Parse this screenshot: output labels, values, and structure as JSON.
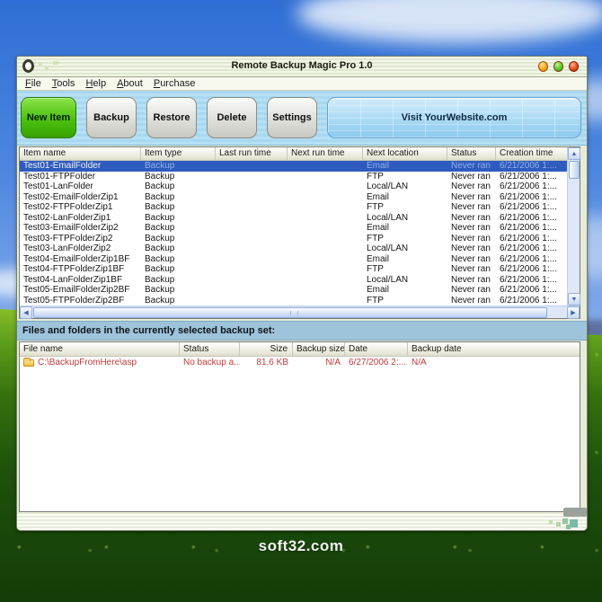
{
  "desktop": {
    "watermark": "soft32.com"
  },
  "window": {
    "title": "Remote Backup Magic Pro 1.0",
    "titlebar_buttons": [
      "minimize",
      "maximize",
      "close"
    ],
    "menu": [
      "File",
      "Tools",
      "Help",
      "About",
      "Purchase"
    ],
    "toolbar": {
      "new_item": "New Item",
      "backup": "Backup",
      "restore": "Restore",
      "delete": "Delete",
      "settings": "Settings",
      "visit": "Visit YourWebsite.com"
    },
    "backup_table": {
      "columns": [
        "Item name",
        "Item type",
        "Last run time",
        "Next run time",
        "Next location",
        "Status",
        "Creation time"
      ],
      "rows": [
        {
          "name": "Test01-EmailFolder",
          "type": "Backup",
          "last_run": "",
          "next_run": "",
          "location": "Email",
          "status": "Never ran",
          "created": "6/21/2006 1:...",
          "selected": true
        },
        {
          "name": "Test01-FTPFolder",
          "type": "Backup",
          "last_run": "",
          "next_run": "",
          "location": "FTP",
          "status": "Never ran",
          "created": "6/21/2006 1:...",
          "selected": false
        },
        {
          "name": "Test01-LanFolder",
          "type": "Backup",
          "last_run": "",
          "next_run": "",
          "location": "Local/LAN",
          "status": "Never ran",
          "created": "6/21/2006 1:...",
          "selected": false
        },
        {
          "name": "Test02-EmailFolderZip1",
          "type": "Backup",
          "last_run": "",
          "next_run": "",
          "location": "Email",
          "status": "Never ran",
          "created": "6/21/2006 1:...",
          "selected": false
        },
        {
          "name": "Test02-FTPFolderZip1",
          "type": "Backup",
          "last_run": "",
          "next_run": "",
          "location": "FTP",
          "status": "Never ran",
          "created": "6/21/2006 1:...",
          "selected": false
        },
        {
          "name": "Test02-LanFolderZip1",
          "type": "Backup",
          "last_run": "",
          "next_run": "",
          "location": "Local/LAN",
          "status": "Never ran",
          "created": "6/21/2006 1:...",
          "selected": false
        },
        {
          "name": "Test03-EmailFolderZip2",
          "type": "Backup",
          "last_run": "",
          "next_run": "",
          "location": "Email",
          "status": "Never ran",
          "created": "6/21/2006 1:...",
          "selected": false
        },
        {
          "name": "Test03-FTPFolderZip2",
          "type": "Backup",
          "last_run": "",
          "next_run": "",
          "location": "FTP",
          "status": "Never ran",
          "created": "6/21/2006 1:...",
          "selected": false
        },
        {
          "name": "Test03-LanFolderZip2",
          "type": "Backup",
          "last_run": "",
          "next_run": "",
          "location": "Local/LAN",
          "status": "Never ran",
          "created": "6/21/2006 1:...",
          "selected": false
        },
        {
          "name": "Test04-EmailFolderZip1BF",
          "type": "Backup",
          "last_run": "",
          "next_run": "",
          "location": "Email",
          "status": "Never ran",
          "created": "6/21/2006 1:...",
          "selected": false
        },
        {
          "name": "Test04-FTPFolderZip1BF",
          "type": "Backup",
          "last_run": "",
          "next_run": "",
          "location": "FTP",
          "status": "Never ran",
          "created": "6/21/2006 1:...",
          "selected": false
        },
        {
          "name": "Test04-LanFolderZip1BF",
          "type": "Backup",
          "last_run": "",
          "next_run": "",
          "location": "Local/LAN",
          "status": "Never ran",
          "created": "6/21/2006 1:...",
          "selected": false
        },
        {
          "name": "Test05-EmailFolderZip2BF",
          "type": "Backup",
          "last_run": "",
          "next_run": "",
          "location": "Email",
          "status": "Never ran",
          "created": "6/21/2006 1:...",
          "selected": false
        },
        {
          "name": "Test05-FTPFolderZip2BF",
          "type": "Backup",
          "last_run": "",
          "next_run": "",
          "location": "FTP",
          "status": "Never ran",
          "created": "6/21/2006 1:...",
          "selected": false
        }
      ]
    },
    "files_label": "Files and folders in the currently selected backup set:",
    "files_table": {
      "columns": [
        "File name",
        "Status",
        "Size",
        "Backup size",
        "Date",
        "Backup date"
      ],
      "rows": [
        {
          "file": "C:\\BackupFromHere\\asp",
          "status": "No backup a...",
          "size": "81.6 KB",
          "backup_size": "N/A",
          "date": "6/27/2006 2:...",
          "backup_date": "N/A",
          "icon": "folder-icon"
        }
      ]
    }
  },
  "colors": {
    "new_item_button": "#4cc10e",
    "visit_button": "#a6d8f4",
    "selected_row": "#2f5bbf",
    "files_alert_text": "#c23a3a",
    "orb_minimize": "#f5a21a",
    "orb_maximize": "#52c81e",
    "orb_close": "#e04818",
    "files_label_bar": "#9ec4dc"
  }
}
